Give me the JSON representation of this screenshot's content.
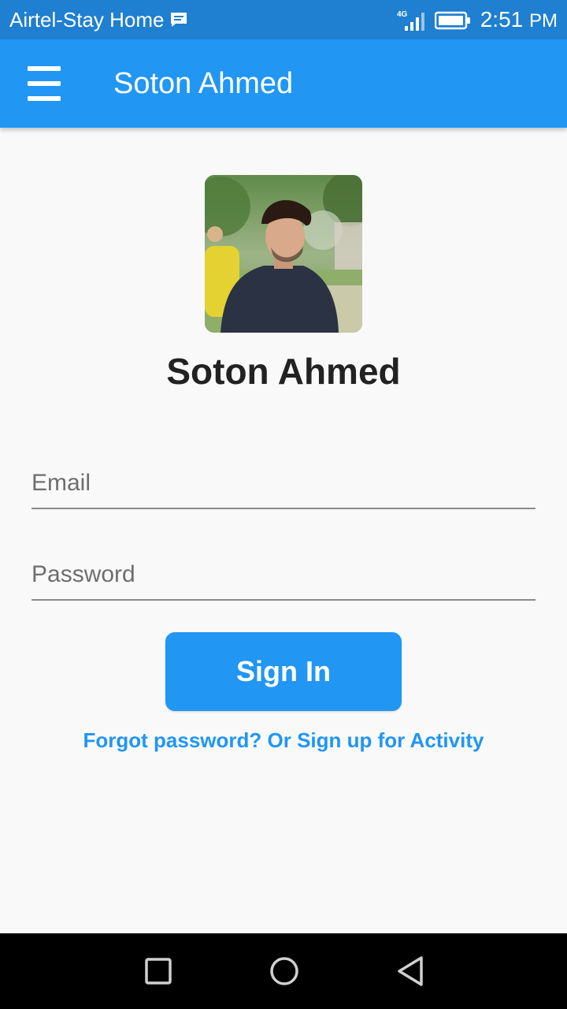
{
  "status_bar": {
    "carrier": "Airtel-Stay Home",
    "network": "4G",
    "time": "2:51",
    "ampm": "PM"
  },
  "app_bar": {
    "title": "Soton Ahmed",
    "menu_icon": "hamburger-menu-icon"
  },
  "profile": {
    "name": "Soton Ahmed"
  },
  "form": {
    "email_placeholder": "Email",
    "email_value": "",
    "password_placeholder": "Password",
    "password_value": "",
    "signin_label": "Sign In",
    "forgot_text": "Forgot password? Or Sign up for Activity"
  },
  "nav_bar": {
    "icons": [
      "recent-apps-icon",
      "home-icon",
      "back-icon"
    ]
  },
  "colors": {
    "primary": "#2196f3",
    "status_bar": "#1f7fd0",
    "background": "#f9f9f9",
    "nav_bar": "#000000"
  }
}
